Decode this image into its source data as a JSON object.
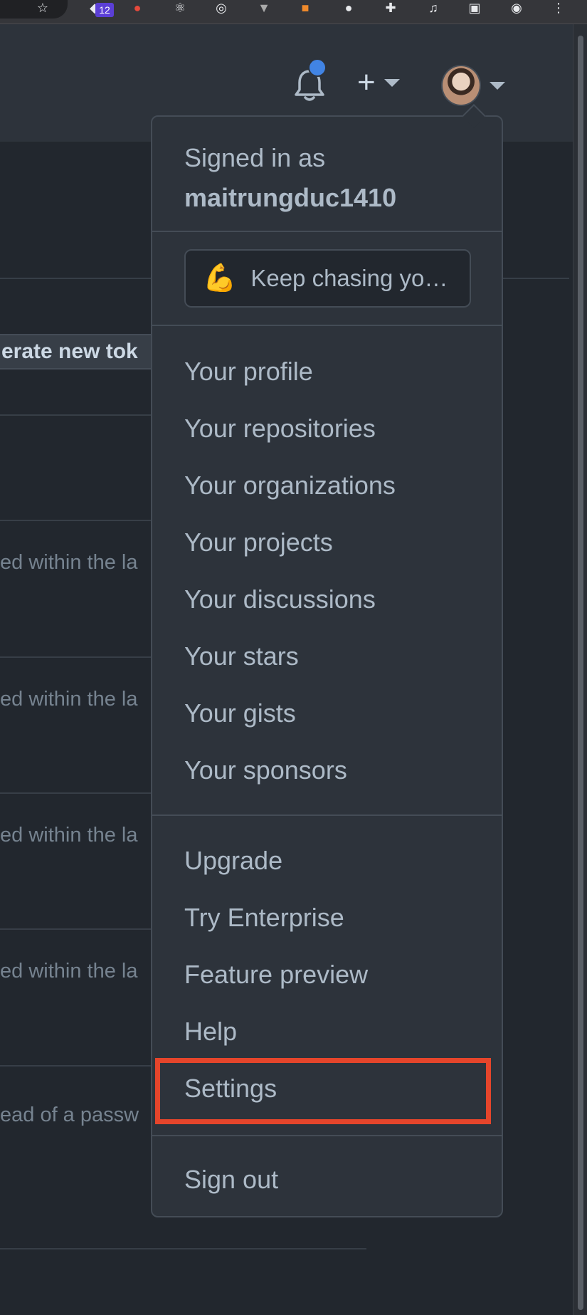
{
  "browser": {
    "extension_badge": "12"
  },
  "header": {
    "notification_dot_color": "#4184e4"
  },
  "background_page": {
    "generate_button": "erate new tok",
    "rows": [
      "ed within the la",
      "ed within the la",
      "ed within the la",
      "ed within the la",
      "ead of a passw"
    ]
  },
  "dropdown": {
    "signed_in_prefix": "Signed in as",
    "username": "maitrungduc1410",
    "status_emoji": "💪",
    "status_text": "Keep chasing yo…",
    "section1": [
      "Your profile",
      "Your repositories",
      "Your organizations",
      "Your projects",
      "Your discussions",
      "Your stars",
      "Your gists",
      "Your sponsors"
    ],
    "section2": [
      "Upgrade",
      "Try Enterprise",
      "Feature preview",
      "Help",
      "Settings"
    ],
    "sign_out": "Sign out"
  },
  "colors": {
    "background": "#22272e",
    "header": "#2d333b",
    "highlight_box": "#e5452b"
  }
}
